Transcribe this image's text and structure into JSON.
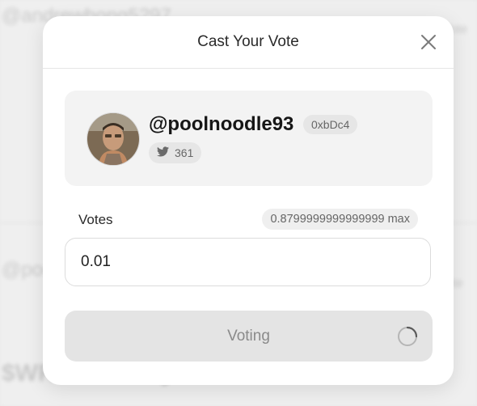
{
  "background": {
    "lines": [
      "@andrewhong5297",
      "0.11 Vote",
      "@poolnoodle93",
      "0.01 Vote",
      "$WRITE lottery"
    ]
  },
  "modal": {
    "title": "Cast Your Vote",
    "close_icon": "close-icon"
  },
  "profile": {
    "handle": "@poolnoodle93",
    "address": "0xbDc4",
    "twitter_icon": "twitter-icon",
    "twitter_count": "361"
  },
  "votes": {
    "label": "Votes",
    "max": "0.8799999999999999 max",
    "value": "0.01"
  },
  "submit": {
    "label": "Voting",
    "spinner_icon": "spinner-icon"
  }
}
